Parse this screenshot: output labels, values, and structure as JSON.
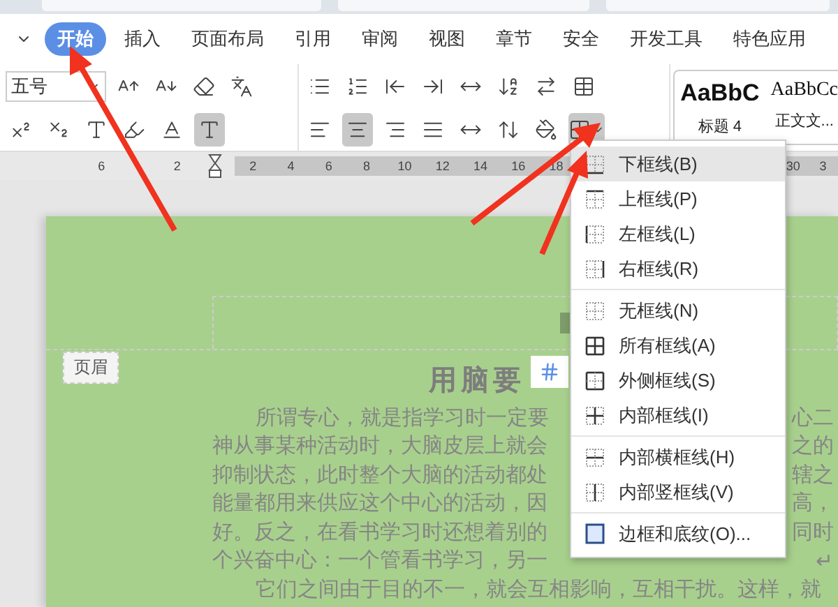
{
  "ribbon": {
    "tabs": [
      {
        "label": "开始",
        "selected": true
      },
      {
        "label": "插入",
        "selected": false
      },
      {
        "label": "页面布局",
        "selected": false
      },
      {
        "label": "引用",
        "selected": false
      },
      {
        "label": "审阅",
        "selected": false
      },
      {
        "label": "视图",
        "selected": false
      },
      {
        "label": "章节",
        "selected": false
      },
      {
        "label": "安全",
        "selected": false
      },
      {
        "label": "开发工具",
        "selected": false
      },
      {
        "label": "特色应用",
        "selected": false
      }
    ]
  },
  "toolbar": {
    "font_size": "五号",
    "alignment": [
      {
        "selected": false
      },
      {
        "selected": true
      },
      {
        "selected": false
      },
      {
        "selected": false
      },
      {
        "selected": false
      }
    ],
    "border_button": {
      "expanded": true
    },
    "styles": [
      {
        "sample": "AaBbC",
        "name": "标题 4"
      },
      {
        "sample": "AaBbCc",
        "name": "正文文..."
      }
    ]
  },
  "ruler": {
    "left_numbers": [
      "6",
      "2"
    ],
    "right_numbers": [
      "2",
      "4",
      "6",
      "8",
      "10",
      "12",
      "14",
      "16",
      "18"
    ],
    "far_numbers": [
      "30",
      "3"
    ]
  },
  "document": {
    "header_tag": "页眉",
    "title": "用脑要",
    "paragraphs": [
      {
        "lines": [
          {
            "text": "所谓专心，就是指学习时一定要",
            "right": "心二"
          },
          {
            "text": "神从事某种活动时，大脑皮层上就会",
            "right": "之的"
          },
          {
            "text": "抑制状态，此时整个大脑的活动都处",
            "right": "辖之"
          },
          {
            "text": "能量都用来供应这个中心的活动，因",
            "right": "高，"
          },
          {
            "text": "好。反之，在看书学习时还想着别的",
            "right": "同时"
          },
          {
            "text": "个兴奋中心：一个管看书学习，另一",
            "right": "↵"
          }
        ]
      },
      {
        "lines": [
          {
            "text": "它们之间由于目的不一，就会互相影响，互相干扰。这样，就"
          }
        ]
      }
    ]
  },
  "border_menu": {
    "groups": [
      [
        {
          "label": "下框线(B)",
          "selected": true
        },
        {
          "label": "上框线(P)",
          "selected": false
        },
        {
          "label": "左框线(L)",
          "selected": false
        },
        {
          "label": "右框线(R)",
          "selected": false
        }
      ],
      [
        {
          "label": "无框线(N)",
          "selected": false
        },
        {
          "label": "所有框线(A)",
          "selected": false
        },
        {
          "label": "外侧框线(S)",
          "selected": false
        },
        {
          "label": "内部框线(I)",
          "selected": false
        }
      ],
      [
        {
          "label": "内部横框线(H)",
          "selected": false
        },
        {
          "label": "内部竖框线(V)",
          "selected": false
        }
      ],
      [
        {
          "label": "边框和底纹(O)...",
          "selected": false
        }
      ]
    ]
  }
}
